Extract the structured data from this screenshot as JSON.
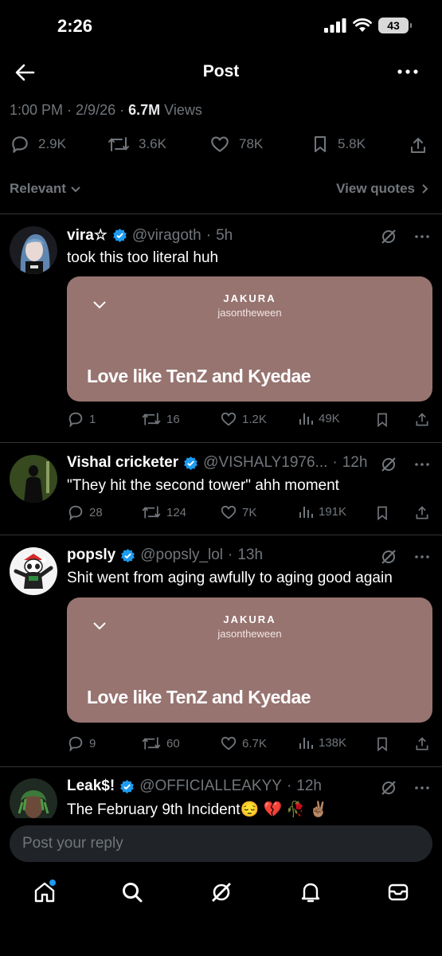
{
  "status_bar": {
    "time": "2:26",
    "battery": "43"
  },
  "header": {
    "title": "Post"
  },
  "post_meta": {
    "time": "1:00 PM",
    "date": "2/9/26",
    "views_count": "6.7M",
    "views_label": "Views"
  },
  "post_stats": {
    "replies": "2.9K",
    "reposts": "3.6K",
    "likes": "78K",
    "bookmarks": "5.8K"
  },
  "sort": {
    "label": "Relevant",
    "view_quotes": "View quotes"
  },
  "replies": [
    {
      "name": "vira☆",
      "handle": "@viragoth",
      "time": "5h",
      "text": "took this too literal huh",
      "card": {
        "artist": "JAKURA",
        "user": "jasontheween",
        "song": "Love like TenZ and Kyedae"
      },
      "actions": {
        "replies": "1",
        "reposts": "16",
        "likes": "1.2K",
        "views": "49K"
      }
    },
    {
      "name": "Vishal cricketer",
      "handle": "@VISHALY1976...",
      "time": "12h",
      "text": "\"They hit the second tower\" ahh moment",
      "actions": {
        "replies": "28",
        "reposts": "124",
        "likes": "7K",
        "views": "191K"
      }
    },
    {
      "name": "popsly",
      "handle": "@popsly_lol",
      "time": "13h",
      "text": "Shit went from aging awfully to aging good again",
      "card": {
        "artist": "JAKURA",
        "user": "jasontheween",
        "song": "Love like TenZ and Kyedae"
      },
      "actions": {
        "replies": "9",
        "reposts": "60",
        "likes": "6.7K",
        "views": "138K"
      }
    },
    {
      "name": "Leak$!",
      "handle": "@OFFICIALLEAKYY",
      "time": "12h",
      "text": "The February 9th Incident😔 💔 🥀 ✌🏽"
    }
  ],
  "composer": {
    "placeholder": "Post your reply"
  },
  "colors": {
    "accent": "#1d9bf0",
    "card_bg": "#977470",
    "muted": "#71767b"
  }
}
